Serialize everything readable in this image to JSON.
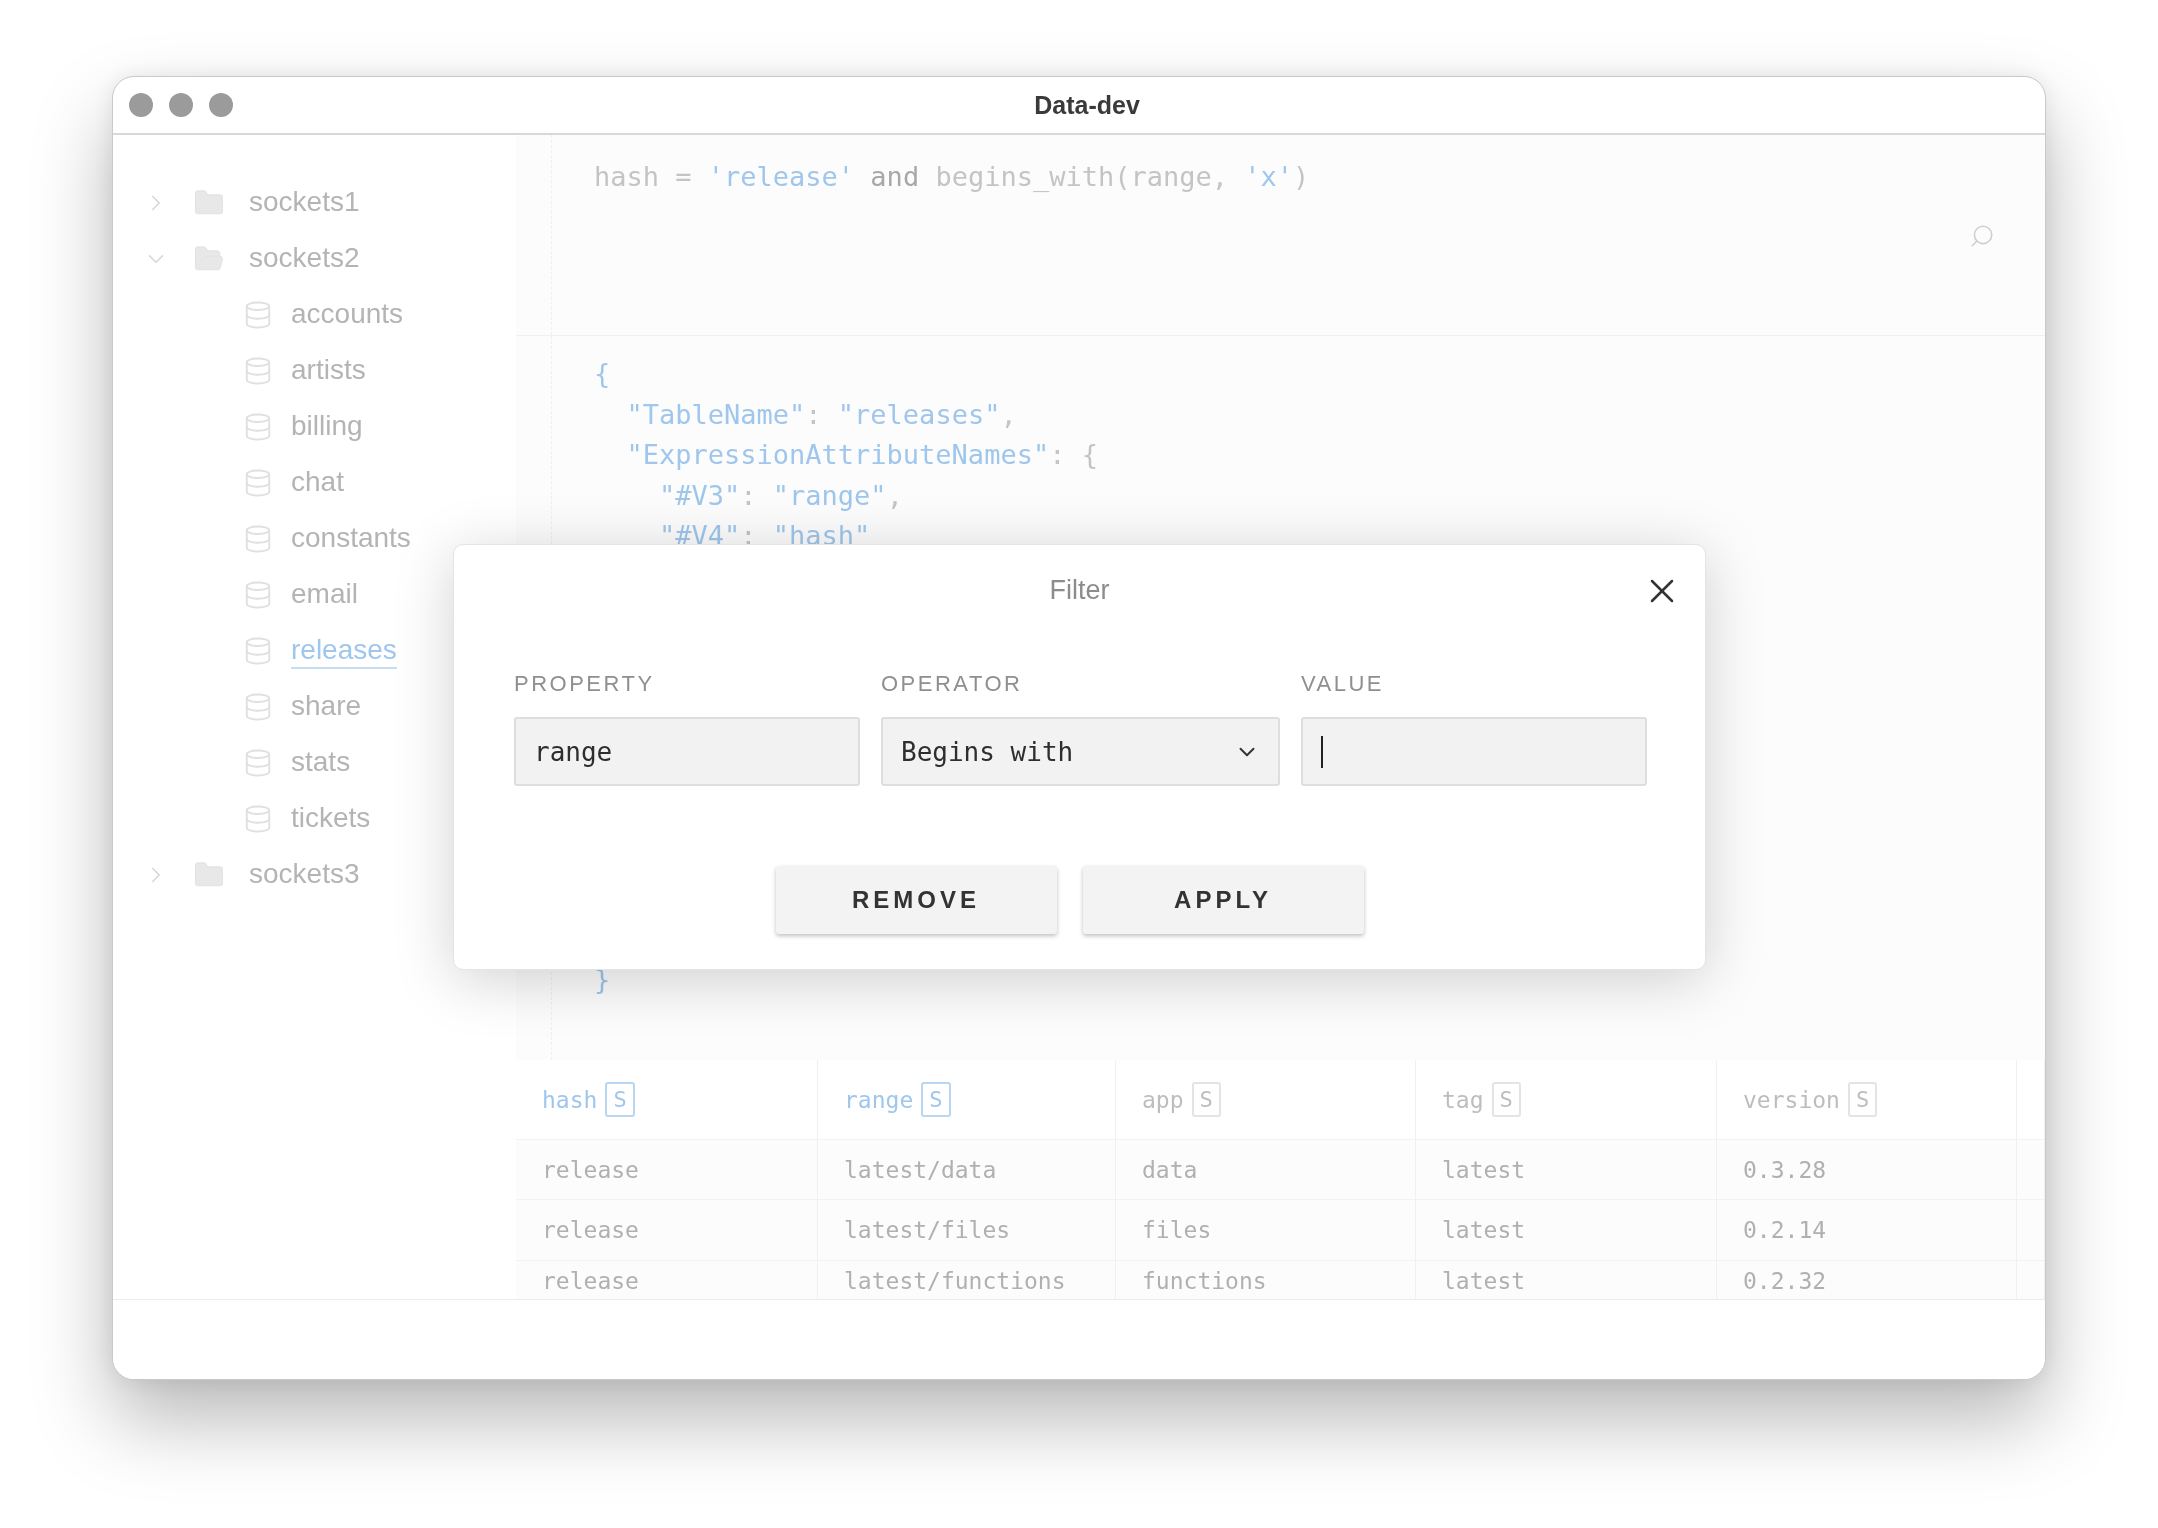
{
  "window": {
    "title": "Data-dev"
  },
  "sidebar": {
    "items": [
      {
        "label": "sockets1",
        "expanded": false,
        "selected": false
      },
      {
        "label": "sockets2",
        "expanded": true,
        "selected": false,
        "children": [
          {
            "label": "accounts",
            "selected": false
          },
          {
            "label": "artists",
            "selected": false
          },
          {
            "label": "billing",
            "selected": false
          },
          {
            "label": "chat",
            "selected": false
          },
          {
            "label": "constants",
            "selected": false
          },
          {
            "label": "email",
            "selected": false
          },
          {
            "label": "releases",
            "selected": true
          },
          {
            "label": "share",
            "selected": false
          },
          {
            "label": "stats",
            "selected": false
          },
          {
            "label": "tickets",
            "selected": false
          }
        ]
      },
      {
        "label": "sockets3",
        "expanded": false,
        "selected": false
      }
    ]
  },
  "query": {
    "tokens": [
      {
        "kind": "plain",
        "text": "hash = "
      },
      {
        "kind": "string",
        "text": "'release'"
      },
      {
        "kind": "keyword",
        "text": " and "
      },
      {
        "kind": "plain",
        "text": "begins_with(range, "
      },
      {
        "kind": "string",
        "text": "'x'"
      },
      {
        "kind": "plain",
        "text": ")"
      }
    ]
  },
  "request_json": {
    "lines": [
      [
        {
          "kind": "string",
          "text": "{"
        }
      ],
      [
        {
          "kind": "string",
          "text": "  \"TableName\""
        },
        {
          "kind": "plain",
          "text": ": "
        },
        {
          "kind": "string",
          "text": "\"releases\""
        },
        {
          "kind": "plain",
          "text": ","
        }
      ],
      [
        {
          "kind": "string",
          "text": "  \"ExpressionAttributeNames\""
        },
        {
          "kind": "plain",
          "text": ": {"
        }
      ],
      [
        {
          "kind": "string",
          "text": "    \"#V3\""
        },
        {
          "kind": "plain",
          "text": ": "
        },
        {
          "kind": "string",
          "text": "\"range\""
        },
        {
          "kind": "plain",
          "text": ","
        }
      ],
      [
        {
          "kind": "string",
          "text": "    \"#V4\""
        },
        {
          "kind": "plain",
          "text": ": "
        },
        {
          "kind": "string",
          "text": "\"hash\""
        }
      ]
    ],
    "closing": "}"
  },
  "table": {
    "columns": [
      {
        "name": "hash",
        "type": "S",
        "key": true
      },
      {
        "name": "range",
        "type": "S",
        "key": true
      },
      {
        "name": "app",
        "type": "S",
        "key": false
      },
      {
        "name": "tag",
        "type": "S",
        "key": false
      },
      {
        "name": "version",
        "type": "S",
        "key": false
      }
    ],
    "rows": [
      [
        "release",
        "latest/data",
        "data",
        "latest",
        "0.3.28"
      ],
      [
        "release",
        "latest/files",
        "files",
        "latest",
        "0.2.14"
      ],
      [
        "release",
        "latest/functions",
        "functions",
        "latest",
        "0.2.32"
      ]
    ]
  },
  "filter_dialog": {
    "title": "Filter",
    "fields": [
      {
        "label": "PROPERTY",
        "kind": "text",
        "value": "range",
        "focused": false
      },
      {
        "label": "OPERATOR",
        "kind": "select",
        "value": "Begins with",
        "focused": false
      },
      {
        "label": "VALUE",
        "kind": "text",
        "focused": true
      }
    ],
    "buttons": [
      "REMOVE",
      "APPLY"
    ]
  }
}
